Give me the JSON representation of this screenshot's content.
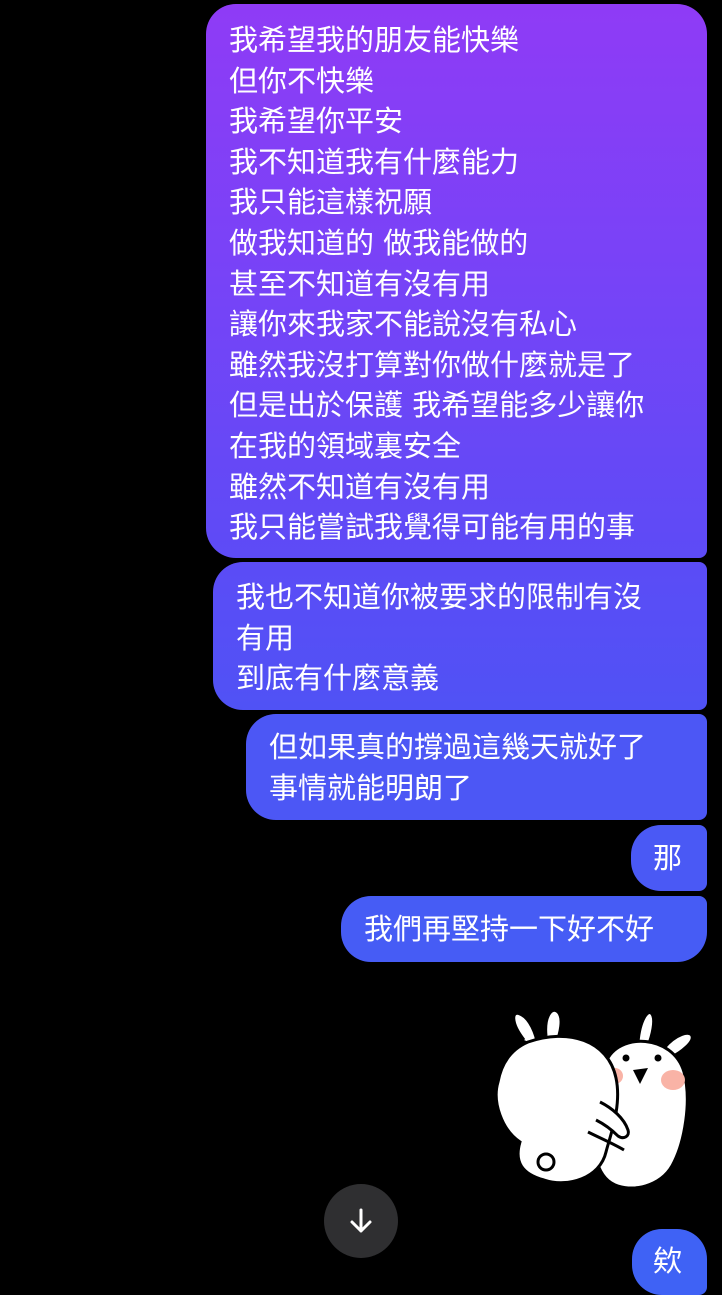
{
  "conversation": {
    "messages": [
      {
        "sender": "self",
        "text": "我希望我的朋友能快樂\n但你不快樂\n我希望你平安\n我不知道我有什麼能力\n我只能這樣祝願\n做我知道的 做我能做的\n甚至不知道有沒有用\n讓你來我家不能說沒有私心\n雖然我沒打算對你做什麼就是了\n但是出於保護 我希望能多少讓你\n在我的領域裏安全\n雖然不知道有沒有用\n我只能嘗試我覺得可能有用的事"
      },
      {
        "sender": "self",
        "text": "我也不知道你被要求的限制有沒\n有用\n到底有什麼意義"
      },
      {
        "sender": "self",
        "text": "但如果真的撐過這幾天就好了\n事情就能明朗了"
      },
      {
        "sender": "self",
        "text": "那"
      },
      {
        "sender": "self",
        "text": "我們再堅持一下好不好"
      },
      {
        "sender": "self",
        "text": "欸"
      }
    ],
    "sticker": {
      "icon": "hugging-rabbits-sticker",
      "sender": "self"
    }
  },
  "controls": {
    "scroll_to_bottom": {
      "icon": "arrow-down-icon"
    }
  },
  "theme": {
    "background": "#000000",
    "bubble_gradient_top": "#8f3bf6",
    "bubble_gradient_bottom": "#3f62f5",
    "text_color": "#ffffff"
  }
}
